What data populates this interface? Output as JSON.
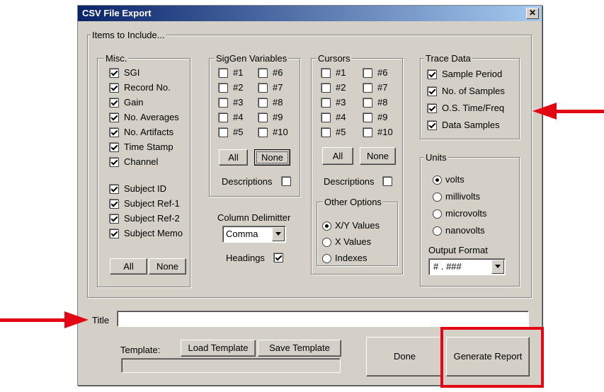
{
  "window": {
    "title": "CSV File Export",
    "close_label": "✕"
  },
  "items_group": {
    "label": "Items to Include..."
  },
  "misc": {
    "label": "Misc.",
    "items": [
      {
        "label": "SGI",
        "checked": true
      },
      {
        "label": "Record No.",
        "checked": true
      },
      {
        "label": "Gain",
        "checked": true
      },
      {
        "label": "No. Averages",
        "checked": true
      },
      {
        "label": "No. Artifacts",
        "checked": true
      },
      {
        "label": "Time Stamp",
        "checked": true
      },
      {
        "label": "Channel",
        "checked": true
      },
      {
        "label": "Subject ID",
        "checked": true
      },
      {
        "label": "Subject Ref-1",
        "checked": true
      },
      {
        "label": "Subject Ref-2",
        "checked": true
      },
      {
        "label": "Subject Memo",
        "checked": true
      }
    ],
    "all_label": "All",
    "none_label": "None"
  },
  "siggen": {
    "label": "SigGen Variables",
    "items": [
      "#1",
      "#2",
      "#3",
      "#4",
      "#5",
      "#6",
      "#7",
      "#8",
      "#9",
      "#10"
    ],
    "all_label": "All",
    "none_label": "None",
    "descriptions_label": "Descriptions"
  },
  "cursors": {
    "label": "Cursors",
    "items": [
      "#1",
      "#2",
      "#3",
      "#4",
      "#5",
      "#6",
      "#7",
      "#8",
      "#9",
      "#10"
    ],
    "all_label": "All",
    "none_label": "None",
    "descriptions_label": "Descriptions"
  },
  "column_delimiter": {
    "label": "Column Delimitter",
    "value": "Comma"
  },
  "headings": {
    "label": "Headings",
    "checked": true
  },
  "other_options": {
    "label": "Other Options",
    "options": [
      {
        "label": "X/Y Values",
        "selected": true
      },
      {
        "label": "X Values",
        "selected": false
      },
      {
        "label": "Indexes",
        "selected": false
      }
    ]
  },
  "trace_data": {
    "label": "Trace Data",
    "items": [
      {
        "label": "Sample Period",
        "checked": true
      },
      {
        "label": "No. of Samples",
        "checked": true
      },
      {
        "label": "O.S. Time/Freq",
        "checked": true
      },
      {
        "label": "Data Samples",
        "checked": true
      }
    ]
  },
  "units": {
    "label": "Units",
    "options": [
      {
        "label": "volts",
        "selected": true
      },
      {
        "label": "millivolts",
        "selected": false
      },
      {
        "label": "microvolts",
        "selected": false
      },
      {
        "label": "nanovolts",
        "selected": false
      }
    ],
    "output_format_label": "Output Format",
    "output_format_value": "# . ###"
  },
  "title_field": {
    "label": "Title",
    "value": ""
  },
  "template": {
    "label": "Template:",
    "load_label": "Load Template",
    "save_label": "Save Template",
    "path_value": ""
  },
  "done_label": "Done",
  "generate_label": "Generate Report",
  "colors": {
    "annotation": "#e30613",
    "titlebar": "#0a246a",
    "face": "#d4d0c8"
  }
}
